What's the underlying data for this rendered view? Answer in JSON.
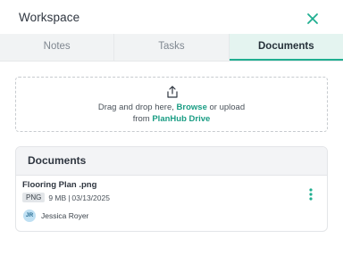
{
  "panel": {
    "title": "Workspace",
    "close_icon": "close-x-icon",
    "accent_color": "#1fae90"
  },
  "tabs": [
    {
      "label": "Notes",
      "active": false
    },
    {
      "label": "Tasks",
      "active": false
    },
    {
      "label": "Documents",
      "active": true
    }
  ],
  "dropzone": {
    "icon": "upload-share-icon",
    "text_before_browse": "Drag and drop here,",
    "browse_link": "Browse",
    "text_after_browse": "or upload",
    "text_from": "from",
    "drive_link": "PlanHub Drive"
  },
  "documents": {
    "header": "Documents",
    "items": [
      {
        "name": "Flooring Plan .png",
        "type_badge": "PNG",
        "size": "9 MB",
        "separator": "|",
        "date": "03/13/2025",
        "uploader_initials": "JR",
        "uploader_name": "Jessica Royer",
        "menu_icon": "kebab-menu-icon"
      }
    ]
  }
}
